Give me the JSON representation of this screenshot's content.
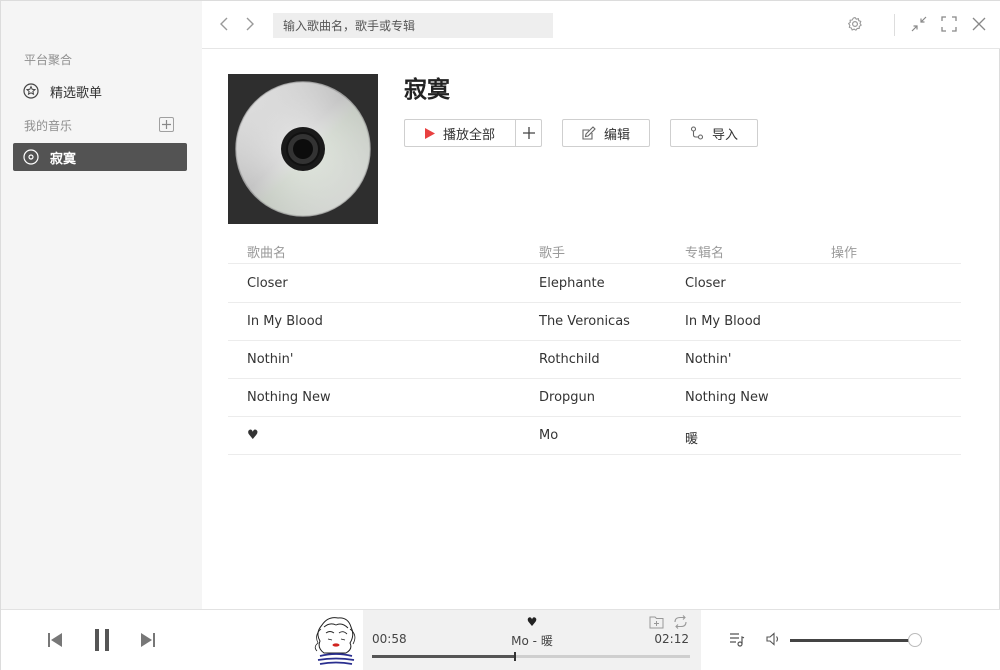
{
  "sidebar": {
    "section_platform": "平台聚合",
    "featured_label": "精选歌单",
    "section_my_music": "我的音乐",
    "playlist_label": "寂寞"
  },
  "topbar": {
    "search_placeholder": "输入歌曲名，歌手或专辑"
  },
  "playlist": {
    "title": "寂寞",
    "play_all_label": "播放全部",
    "edit_label": "编辑",
    "import_label": "导入"
  },
  "table": {
    "columns": [
      "歌曲名",
      "歌手",
      "专辑名",
      "操作"
    ],
    "rows": [
      {
        "song": "Closer",
        "artist": "Elephante",
        "album": "Closer"
      },
      {
        "song": "In My Blood",
        "artist": "The Veronicas",
        "album": "In My Blood"
      },
      {
        "song": "Nothin'",
        "artist": "Rothchild",
        "album": "Nothin'"
      },
      {
        "song": "Nothing New",
        "artist": "Dropgun",
        "album": "Nothing New"
      },
      {
        "song": "♥",
        "artist": "Mo",
        "album": "暖"
      }
    ]
  },
  "player": {
    "song_title": "♥",
    "now_playing": "Mo - 暖",
    "current_time": "00:58",
    "total_time": "02:12",
    "progress": 0.45,
    "volume": 0.95
  },
  "colors": {
    "sidebar_bg": "#f5f5f5",
    "active_item_bg": "#535353",
    "play_icon": "#e84040"
  },
  "icons": [
    "back-arrow-icon",
    "forward-arrow-icon",
    "gear-icon",
    "compress-icon",
    "fullscreen-icon",
    "close-icon",
    "star-icon",
    "disc-icon",
    "plus-icon",
    "play-icon",
    "edit-icon",
    "import-icon",
    "prev-icon",
    "pause-icon",
    "next-icon",
    "add-to-playlist-icon",
    "repeat-icon",
    "playlist-icon",
    "volume-icon"
  ]
}
